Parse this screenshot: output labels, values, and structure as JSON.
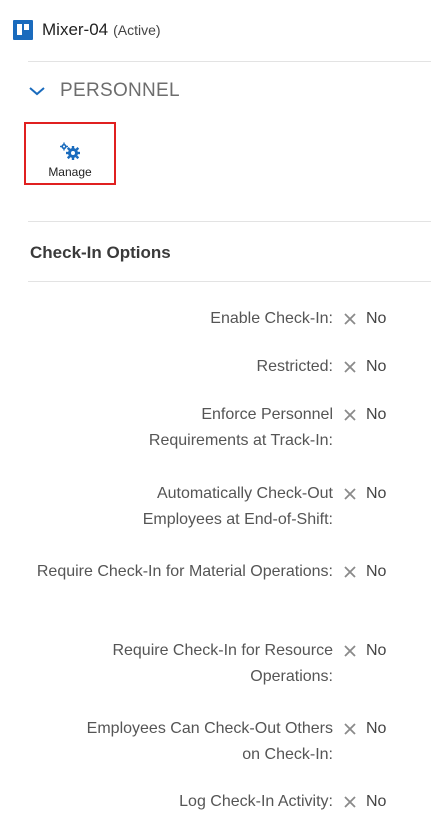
{
  "resource": {
    "name": "Mixer-04",
    "state": "(Active)",
    "icon": "resource-board-icon",
    "icon_color": "#1a6bbd"
  },
  "section": {
    "label": "PERSONNEL",
    "icon": "chevron-down-icon"
  },
  "manage": {
    "label": "Manage",
    "icon": "gears-icon",
    "icon_color": "#1a6bbd",
    "highlight_color": "#e02020"
  },
  "check_in_options": {
    "title": "Check-In Options",
    "value_icon": "x-icon",
    "items": [
      {
        "label": "Enable Check-In:",
        "value": "No"
      },
      {
        "label": "Restricted:",
        "value": "No"
      },
      {
        "label": "Enforce Personnel Requirements at Track-In:",
        "value": "No"
      },
      {
        "label": "Automatically Check-Out Employees at End-of-Shift:",
        "value": "No"
      },
      {
        "label": "Require Check-In for Material Operations:",
        "value": "No"
      },
      {
        "label": "Require Check-In for Resource Operations:",
        "value": "No"
      },
      {
        "label": "Employees Can Check-Out Others on Check-In:",
        "value": "No"
      },
      {
        "label": "Log Check-In Activity:",
        "value": "No"
      }
    ]
  }
}
